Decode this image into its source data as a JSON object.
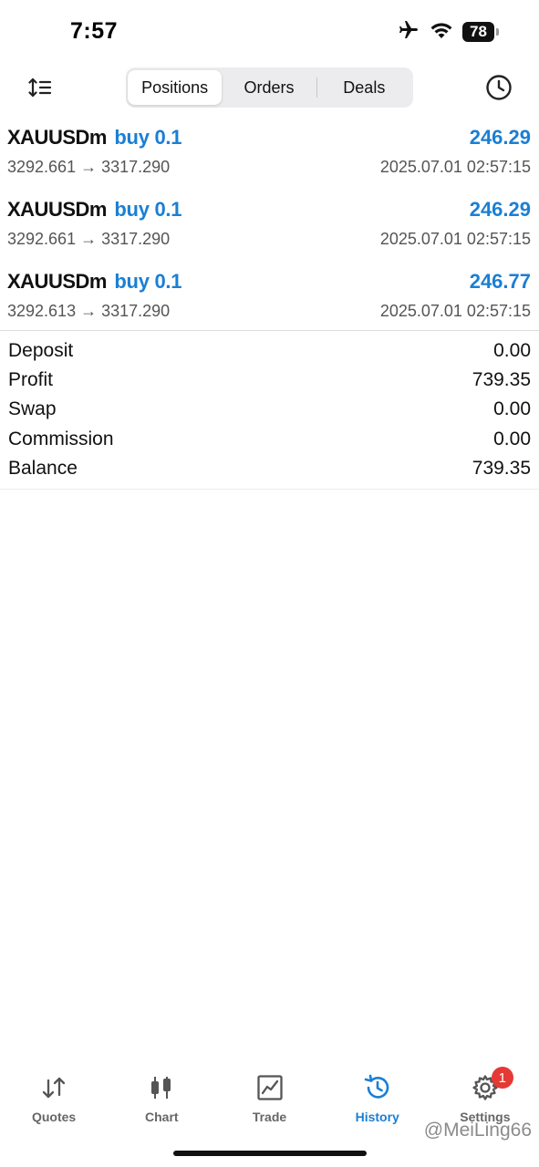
{
  "status_bar": {
    "time": "7:57",
    "battery": "78"
  },
  "toolbar": {
    "tabs": [
      {
        "label": "Positions",
        "active": true
      },
      {
        "label": "Orders",
        "active": false
      },
      {
        "label": "Deals",
        "active": false
      }
    ],
    "left_icon": "sort-icon",
    "right_icon": "clock-icon"
  },
  "positions": [
    {
      "symbol": "XAUUSDm",
      "side": "buy 0.1",
      "profit": "246.29",
      "prices": "3292.661 → 3317.290",
      "time": "2025.07.01 02:57:15"
    },
    {
      "symbol": "XAUUSDm",
      "side": "buy 0.1",
      "profit": "246.29",
      "prices": "3292.661 → 3317.290",
      "time": "2025.07.01 02:57:15"
    },
    {
      "symbol": "XAUUSDm",
      "side": "buy 0.1",
      "profit": "246.77",
      "prices": "3292.613 → 3317.290",
      "time": "2025.07.01 02:57:15"
    }
  ],
  "summary": [
    {
      "label": "Deposit",
      "value": "0.00"
    },
    {
      "label": "Profit",
      "value": "739.35"
    },
    {
      "label": "Swap",
      "value": "0.00"
    },
    {
      "label": "Commission",
      "value": "0.00"
    },
    {
      "label": "Balance",
      "value": "739.35"
    }
  ],
  "tabbar": {
    "tabs": [
      {
        "label": "Quotes",
        "icon": "quotes-icon",
        "active": false
      },
      {
        "label": "Chart",
        "icon": "chart-icon",
        "active": false
      },
      {
        "label": "Trade",
        "icon": "trade-icon",
        "active": false
      },
      {
        "label": "History",
        "icon": "history-icon",
        "active": true
      },
      {
        "label": "Settings",
        "icon": "gear-icon",
        "active": false,
        "badge": "1"
      }
    ]
  },
  "watermark": "@MeiLing66",
  "colors": {
    "accent": "#1a7fd4",
    "badge": "#e53935"
  }
}
